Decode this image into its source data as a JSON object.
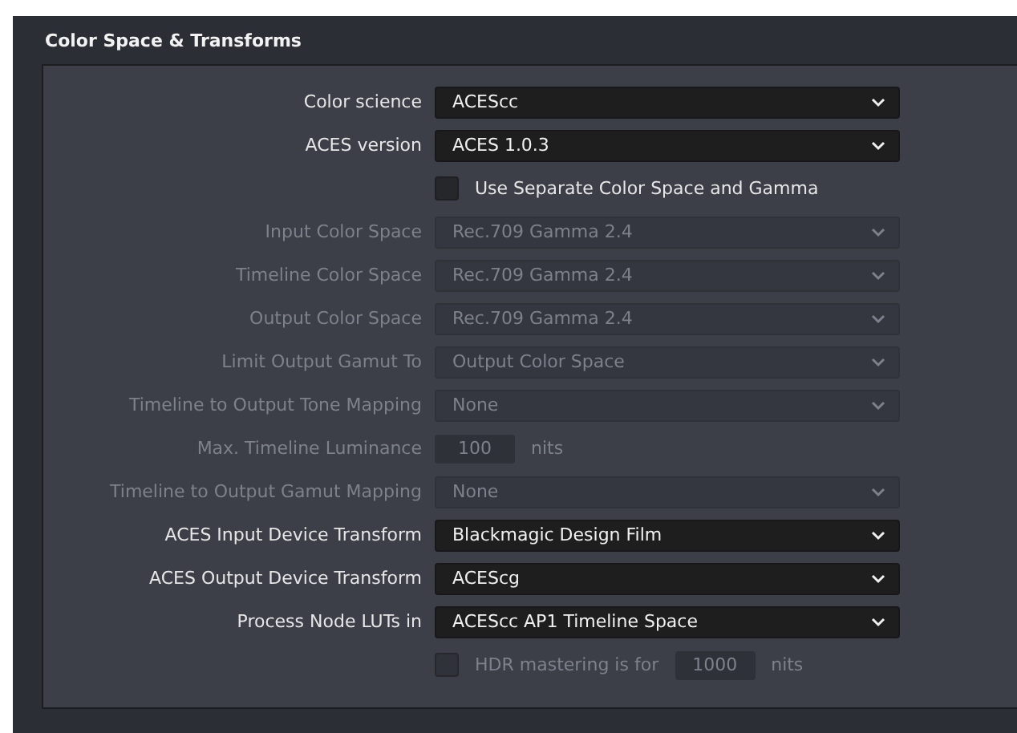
{
  "panel": {
    "title": "Color Space & Transforms"
  },
  "rows": [
    {
      "kind": "dropdown",
      "label": "Color science",
      "value": "ACEScc",
      "disabled": false
    },
    {
      "kind": "dropdown",
      "label": "ACES version",
      "value": "ACES 1.0.3",
      "disabled": false
    },
    {
      "kind": "checkbox",
      "label": "Use Separate Color Space and Gamma",
      "checked": false,
      "disabled": false
    },
    {
      "kind": "dropdown",
      "label": "Input Color Space",
      "value": "Rec.709 Gamma 2.4",
      "disabled": true
    },
    {
      "kind": "dropdown",
      "label": "Timeline Color Space",
      "value": "Rec.709 Gamma 2.4",
      "disabled": true
    },
    {
      "kind": "dropdown",
      "label": "Output Color Space",
      "value": "Rec.709 Gamma 2.4",
      "disabled": true
    },
    {
      "kind": "dropdown",
      "label": "Limit Output Gamut To",
      "value": "Output Color Space",
      "disabled": true
    },
    {
      "kind": "dropdown",
      "label": "Timeline to Output Tone Mapping",
      "value": "None",
      "disabled": true
    },
    {
      "kind": "number",
      "label": "Max. Timeline Luminance",
      "value": "100",
      "unit": "nits",
      "disabled": true
    },
    {
      "kind": "dropdown",
      "label": "Timeline to Output Gamut Mapping",
      "value": "None",
      "disabled": true
    },
    {
      "kind": "dropdown",
      "label": "ACES Input Device Transform",
      "value": "Blackmagic Design Film",
      "disabled": false
    },
    {
      "kind": "dropdown",
      "label": "ACES Output Device Transform",
      "value": "ACEScg",
      "disabled": false
    },
    {
      "kind": "dropdown",
      "label": "Process Node LUTs in",
      "value": "ACEScc AP1 Timeline Space",
      "disabled": false
    },
    {
      "kind": "checknumber",
      "label": "HDR mastering is for",
      "value": "1000",
      "unit": "nits",
      "checked": false,
      "disabled": true
    }
  ]
}
